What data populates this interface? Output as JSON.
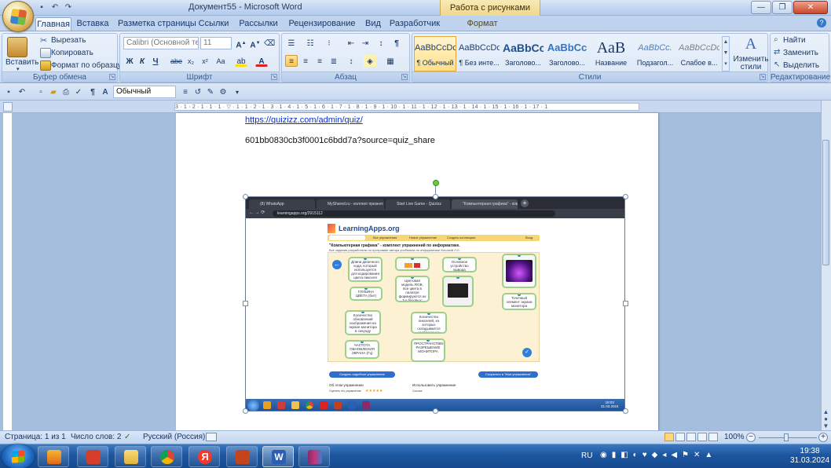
{
  "title_bar": {
    "app_title": "Документ55 - Microsoft Word",
    "context_title": "Работа с рисунками"
  },
  "tabs": [
    "Главная",
    "Вставка",
    "Разметка страницы",
    "Ссылки",
    "Рассылки",
    "Рецензирование",
    "Вид",
    "Разработчик",
    "Формат"
  ],
  "ribbon": {
    "clipboard": {
      "title": "Буфер обмена",
      "paste": "Вставить",
      "cut": "Вырезать",
      "copy": "Копировать",
      "format_painter": "Формат по образцу"
    },
    "font": {
      "title": "Шрифт",
      "font_name": "Calibri (Основной те",
      "font_size": "11"
    },
    "paragraph": {
      "title": "Абзац"
    },
    "styles": {
      "title": "Стили",
      "items": [
        {
          "preview": "AaBbCcDc",
          "name": "¶ Обычный"
        },
        {
          "preview": "AaBbCcDc",
          "name": "¶ Без инте..."
        },
        {
          "preview": "AaBbCc",
          "name": "Заголово..."
        },
        {
          "preview": "AaBbCc",
          "name": "Заголово..."
        },
        {
          "preview": "АаВ",
          "name": "Название"
        },
        {
          "preview": "AaBbCc.",
          "name": "Подзагол..."
        },
        {
          "preview": "AaBbCcDc",
          "name": "Слабое в..."
        }
      ],
      "change_styles": "Изменить стили"
    },
    "editing": {
      "title": "Редактирование",
      "find": "Найти",
      "replace": "Заменить",
      "select": "Выделить"
    }
  },
  "format_toolbar": {
    "style_value": "Обычный"
  },
  "ruler": {
    "marks": "3 · 1 · 2 · 1 · 1 · 1 · ▽ · 1 · 1 · 2 · 1 · 3 · 1 · 4 · 1 · 5 · 1 · 6 · 1 · 7 · 1 · 8 · 1 · 9 · 1 · 10 · 1 · 11 · 1 · 12 · 1 · 13 · 1 · 14 · 1 · 15 · 1 · 16 · 1 · 17 · 1"
  },
  "document": {
    "link": "https://quizizz.com/admin/quiz/",
    "line2": "601bb0830cb3f0001c6bdd7a?source=quiz_share"
  },
  "screenshot": {
    "browser_tabs": [
      "(8) WhatsApp",
      "MyShared.ru - коллект презент...",
      "Start Live Game - Quizizz",
      "\"Компьютерная графика\" - ком..."
    ],
    "address": "learningapps.org/2915112",
    "site_logo": "LearningApps.org",
    "nav": [
      "Все упражнения",
      "Новое упражнение",
      "Создать коллекцию",
      "Вход"
    ],
    "heading": "\"Компьютерная графика\" - комплект упражнений по информатике.",
    "subheading": "Все задания разработаны по программе автора учебников по информатике Босовой Л.Л.",
    "cards": [
      "Длина двоичного кода, который используется для кодирования цвета пикселя",
      "ГЛУБИНА ЦВЕТА (бит)",
      "Цветовая модель RGB, все цвета в палитре формируются из 3-х базовых: красный, зеленый и синий",
      "Основное устройство вывода информации",
      "Точечный элемент экрана монитора",
      "Количество обновлений изображения на экране монитора в секунду",
      "ЧАСТОТА ОБНОВЛЕНИЯ ЭКРАНА (Гц)",
      "Количество пикселей, из которых складывается изображение",
      "ПРОСТРАНСТВЕННОЕ РАЗРЕШЕНИЕ МОНИТОРА"
    ],
    "btn_similar": "Создать подобное упражнение",
    "btn_save": "Сохранить в \"Мои упражнения\"",
    "footer_left": "Об этом упражнении",
    "footer_mid": "Использовать упражнение",
    "footer_rating": "Оценить это упражнение",
    "footer_link": "Ссылка",
    "taskbar_time": "18:03",
    "taskbar_date": "31.03.2024"
  },
  "status_bar": {
    "page": "Страница: 1 из 1",
    "words": "Число слов: 2",
    "language": "Русский (Россия)",
    "zoom": "100%"
  },
  "taskbar": {
    "lang": "RU",
    "time": "19:38",
    "date": "31.03.2024"
  }
}
